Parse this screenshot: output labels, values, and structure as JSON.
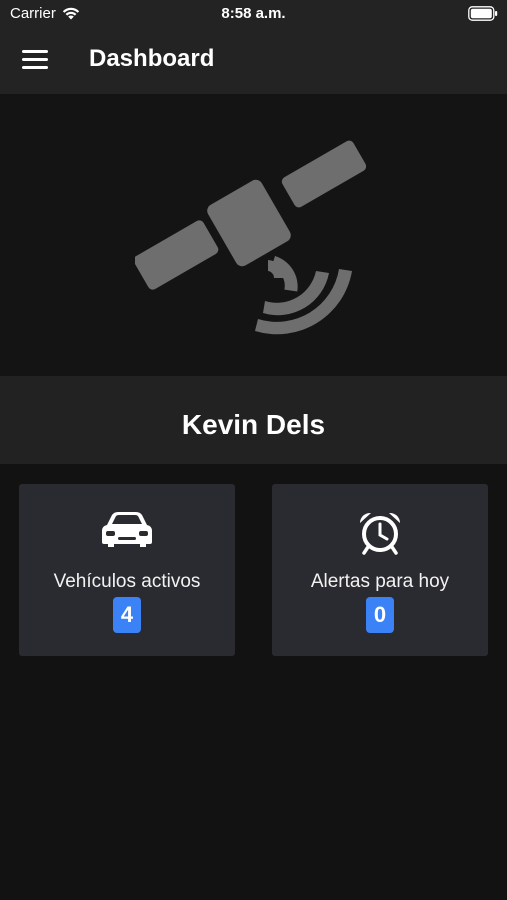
{
  "status_bar": {
    "carrier": "Carrier",
    "time": "8:58 a.m."
  },
  "header": {
    "title": "Dashboard"
  },
  "user": {
    "name": "Kevin Dels"
  },
  "cards": [
    {
      "label": "Vehículos activos",
      "count": "4",
      "icon": "car-icon"
    },
    {
      "label": "Alertas para hoy",
      "count": "0",
      "icon": "alarm-clock-icon"
    }
  ],
  "colors": {
    "background": "#121212",
    "bar": "#232323",
    "card": "#2a2b30",
    "badge": "#3b82f6",
    "satellite": "#6e6e6e"
  }
}
